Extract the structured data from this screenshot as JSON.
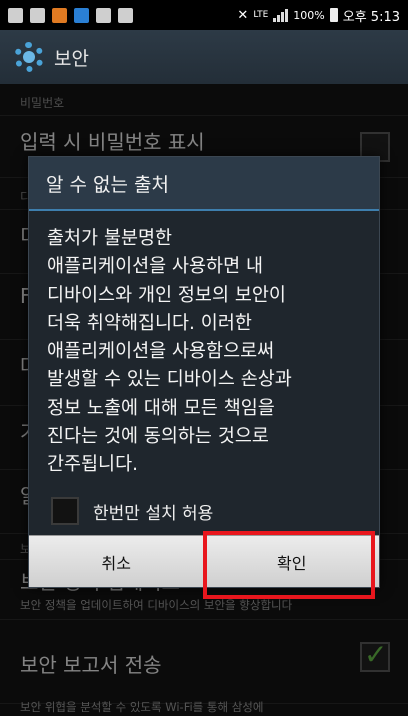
{
  "status_bar": {
    "network": "LTE",
    "battery": "100%",
    "time": "오후 5:13"
  },
  "header": {
    "title": "보안"
  },
  "settings": {
    "section_password": "비밀번호",
    "row_password_visible": "입력 시 비밀번호 표시",
    "section_device": "디",
    "row_d": "디",
    "row_f": "F",
    "row_j": "다",
    "row_k": "기",
    "row_s": "알",
    "section_b": "보",
    "row_update_title": "보안 정책 업데이트",
    "row_update_sub": "보안 정책을 업데이트하여 디바이스의 보안을 향상합니다",
    "row_report_title": "보안 보고서 전송",
    "row_report_sub": "보안 위협을 분석할 수 있도록 Wi-Fi를 통해 삼성에\n보안 보고서를 전송합니다"
  },
  "dialog": {
    "title": "알 수 없는 출처",
    "message": "출처가 불분명한\n애플리케이션을 사용하면 내\n디바이스와 개인 정보의 보안이\n더욱 취약해집니다. 이러한\n애플리케이션을 사용함으로써\n발생할 수 있는 디바이스 손상과\n정보 노출에 대해 모든 책임을\n진다는 것에 동의하는 것으로\n간주됩니다.",
    "checkbox_label": "한번만 설치 허용",
    "cancel_label": "취소",
    "ok_label": "확인"
  },
  "colors": {
    "accent": "#3e7fae",
    "highlight": "#e8161d",
    "check": "#69c04a"
  }
}
